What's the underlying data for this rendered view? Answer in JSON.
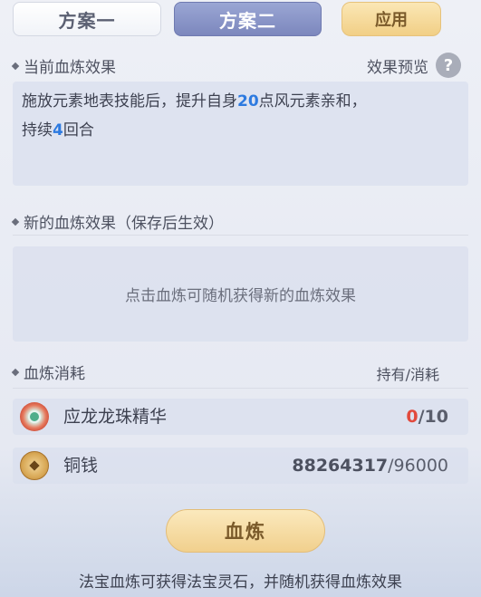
{
  "tabs": {
    "plan1": "方案一",
    "plan2": "方案二",
    "apply": "应用"
  },
  "current": {
    "title": "当前血炼效果",
    "preview_label": "效果预览",
    "help_icon_text": "?",
    "effect_part1": "施放元素地表技能后，提升自身",
    "effect_value1": "20",
    "effect_part2": "点风元素亲和，",
    "effect_part3": "持续",
    "effect_value2": "4",
    "effect_part4": "回合"
  },
  "new_effect": {
    "title": "新的血炼效果（保存后生效）",
    "hint": "点击血炼可随机获得新的血炼效果"
  },
  "cost": {
    "title": "血炼消耗",
    "header_right": "持有/消耗",
    "items": [
      {
        "name": "应龙龙珠精华",
        "icon": "dragon-orb-icon",
        "have": "0",
        "need": "/10"
      },
      {
        "name": "铜钱",
        "icon": "copper-coin-icon",
        "have": "88264317",
        "need": "/96000"
      }
    ]
  },
  "refine_button": "血炼",
  "footer": "法宝血炼可获得法宝灵石，并随机获得血炼效果",
  "colors": {
    "highlight_blue": "#2d7ae0",
    "insufficient_red": "#e24a3d",
    "gold_button": "#f1d08d"
  }
}
